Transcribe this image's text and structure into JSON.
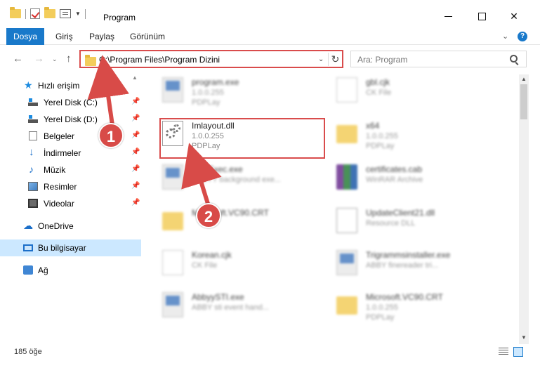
{
  "window": {
    "title": "Program",
    "icons": [
      "folder-icon",
      "properties-check-icon",
      "new-folder-icon"
    ]
  },
  "ribbon": {
    "tabs": [
      "Dosya",
      "Giriş",
      "Paylaş",
      "Görünüm"
    ],
    "active_tab": "Dosya",
    "help": "?"
  },
  "nav": {
    "back": "←",
    "forward": "→",
    "dropdown": "⌄",
    "up": "↑",
    "address": "C:\\Program Files\\Program Dizini",
    "address_dropdown": "⌄",
    "refresh": "↻",
    "search_placeholder": "Ara: Program"
  },
  "sidebar": {
    "items": [
      {
        "label": "Hızlı erişim",
        "icon": "quick-access-star-icon",
        "pinned": false
      },
      {
        "label": "Yerel Disk (C:)",
        "icon": "drive-icon",
        "pinned": true
      },
      {
        "label": "Yerel Disk (D:)",
        "icon": "drive-icon",
        "pinned": true
      },
      {
        "label": "Belgeler",
        "icon": "documents-icon",
        "pinned": true
      },
      {
        "label": "İndirmeler",
        "icon": "downloads-icon",
        "pinned": true
      },
      {
        "label": "Müzik",
        "icon": "music-icon",
        "pinned": true
      },
      {
        "label": "Resimler",
        "icon": "pictures-icon",
        "pinned": true
      },
      {
        "label": "Videolar",
        "icon": "videos-icon",
        "pinned": true
      },
      {
        "label": "OneDrive",
        "icon": "onedrive-icon",
        "pinned": false
      },
      {
        "label": "Bu bilgisayar",
        "icon": "this-pc-icon",
        "pinned": false,
        "selected": true
      },
      {
        "label": "Ağ",
        "icon": "network-icon",
        "pinned": false
      }
    ],
    "pin_glyph": "📌"
  },
  "files": [
    {
      "name": "program.exe",
      "line2": "1.0.0.255",
      "line3": "PDPLay",
      "kind": "exe",
      "blurred": true
    },
    {
      "name": "gbl.cjk",
      "line2": "CK File",
      "line3": "",
      "kind": "file",
      "blurred": true
    },
    {
      "name": "Imlayout.dll",
      "line2": "1.0.0.255",
      "line3": "PDPLay",
      "kind": "dll",
      "blurred": false,
      "highlighted": true
    },
    {
      "name": "x64",
      "line2": "1.0.0.255",
      "line3": "PDPLay",
      "kind": "folder",
      "blurred": true
    },
    {
      "name": "FineExec.exe",
      "line2": "ABBYY background exe...",
      "line3": "",
      "kind": "exe",
      "blurred": true
    },
    {
      "name": "certificates.cab",
      "line2": "WinRAR Archive",
      "line3": "",
      "kind": "rar",
      "blurred": true
    },
    {
      "name": "Microsoft.VC90.CRT",
      "line2": "",
      "line3": "",
      "kind": "folder",
      "blurred": true
    },
    {
      "name": "UpdateClient21.dll",
      "line2": "Resource DLL",
      "line3": "",
      "kind": "dll",
      "blurred": true
    },
    {
      "name": "Korean.cjk",
      "line2": "CK File",
      "line3": "",
      "kind": "file",
      "blurred": true
    },
    {
      "name": "Trigrammsinstaller.exe",
      "line2": "ABBY finereader tri...",
      "line3": "",
      "kind": "exe",
      "blurred": true
    },
    {
      "name": "AbbyySTI.exe",
      "line2": "ABBY sti event hand...",
      "line3": "",
      "kind": "exe",
      "blurred": true
    },
    {
      "name": "Microsoft.VC90.CRT",
      "line2": "1.0.0.255",
      "line3": "PDPLay",
      "kind": "folder",
      "blurred": true
    }
  ],
  "status": {
    "count": "185 öğe"
  },
  "callouts": [
    "1",
    "2"
  ],
  "colors": {
    "accent": "#1979ca",
    "selection": "#cce8ff",
    "highlight": "#d94c4c"
  }
}
